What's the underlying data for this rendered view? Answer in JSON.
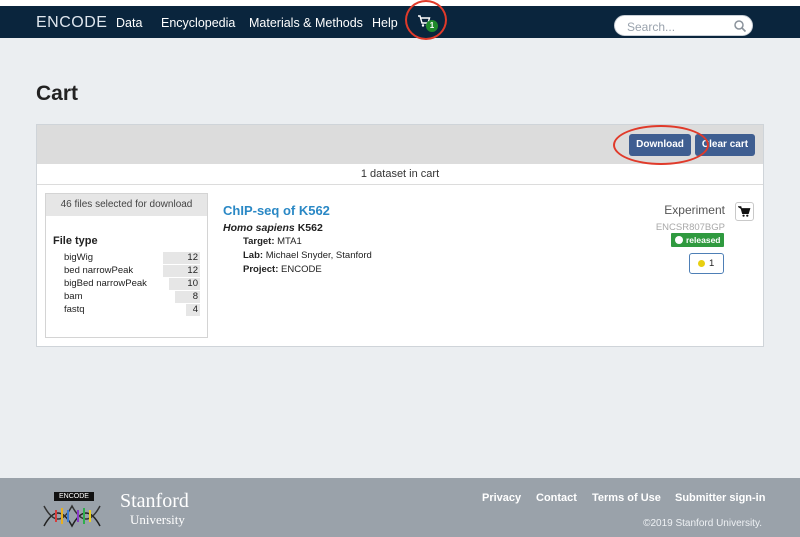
{
  "nav": {
    "brand": "ENCODE",
    "items": [
      "Data",
      "Encyclopedia",
      "Materials & Methods",
      "Help"
    ],
    "cart_count": "1",
    "search_placeholder": "Search..."
  },
  "page": {
    "title": "Cart"
  },
  "cart": {
    "download_label": "Download",
    "clear_label": "Clear cart",
    "dataset_count_text": "1 dataset in cart",
    "facet": {
      "header": "46 files selected for download",
      "title": "File type",
      "items": [
        {
          "label": "bigWig",
          "count": "12"
        },
        {
          "label": "bed narrowPeak",
          "count": "12"
        },
        {
          "label": "bigBed narrowPeak",
          "count": "10"
        },
        {
          "label": "bam",
          "count": "8"
        },
        {
          "label": "fastq",
          "count": "4"
        }
      ]
    },
    "result": {
      "title": "ChIP-seq of K562",
      "species": "Homo sapiens",
      "biosample": "K562",
      "target_label": "Target:",
      "target": "MTA1",
      "lab_label": "Lab:",
      "lab": "Michael Snyder, Stanford",
      "project_label": "Project:",
      "project": "ENCODE",
      "type": "Experiment",
      "accession": "ENCSR807BGP",
      "status": "released",
      "audit_count": "1"
    }
  },
  "footer": {
    "logo_tag": "ENCODE",
    "stanford": "Stanford",
    "university": "University",
    "links": [
      "Privacy",
      "Contact",
      "Terms of Use",
      "Submitter sign-in"
    ],
    "copyright": "©2019 Stanford University."
  },
  "colors": {
    "navbar": "#0a253d",
    "button": "#3f5e91",
    "link": "#2a88c5",
    "released": "#2f9a3f",
    "annotation": "#e03a2a",
    "footer": "#9aa2aa"
  }
}
